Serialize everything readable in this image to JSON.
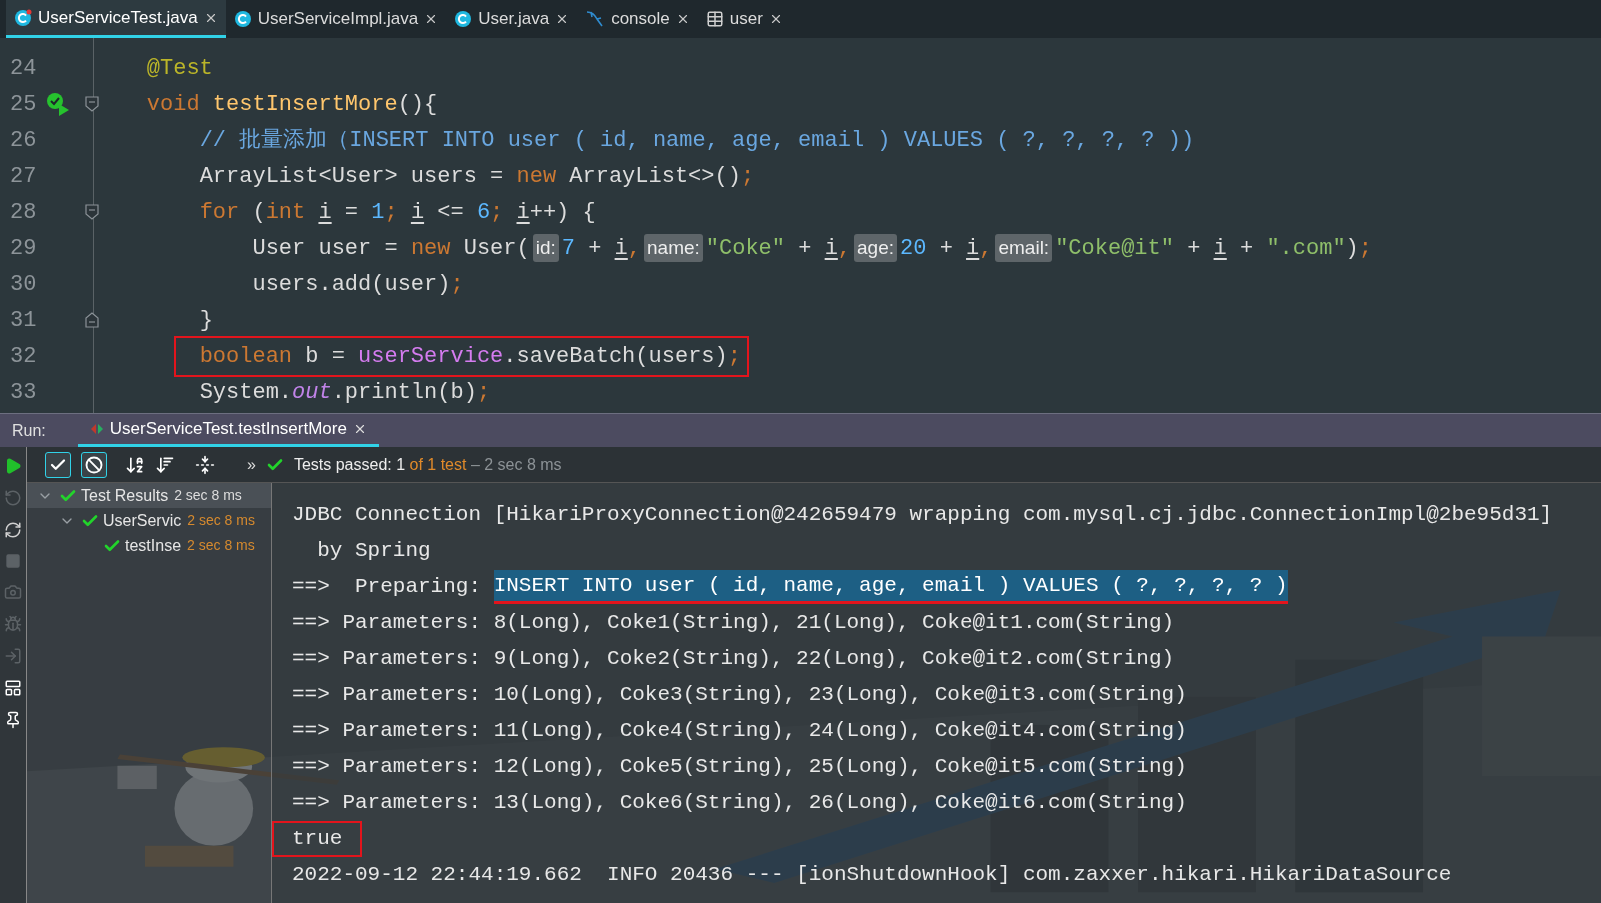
{
  "tabs": [
    {
      "label": "UserServiceTest.java",
      "kind": "test-class",
      "selected": true
    },
    {
      "label": "UserServiceImpl.java",
      "kind": "class",
      "selected": false
    },
    {
      "label": "User.java",
      "kind": "class",
      "selected": false
    },
    {
      "label": "console",
      "kind": "console",
      "selected": false
    },
    {
      "label": "user",
      "kind": "table",
      "selected": false
    }
  ],
  "editor": {
    "lines": [
      {
        "number": "24",
        "kind": "code",
        "run_icon": false,
        "boxed": false,
        "tokens": [
          {
            "kind": "annotation",
            "text": "    @Test"
          }
        ]
      },
      {
        "number": "25",
        "kind": "fold-start",
        "run_icon": true,
        "boxed": false,
        "tokens": [
          {
            "kind": "keyword",
            "text": "    void"
          },
          {
            "kind": "method",
            "text": " testInsertMore"
          },
          {
            "kind": "plain",
            "text": "(){"
          }
        ]
      },
      {
        "number": "26",
        "kind": "code",
        "run_icon": false,
        "boxed": false,
        "tokens": [
          {
            "kind": "comment",
            "text": "        // 批量添加（INSERT INTO user ( id, name, age, email ) VALUES ( ?, ?, ?, ? ))"
          }
        ]
      },
      {
        "number": "27",
        "kind": "code",
        "run_icon": false,
        "boxed": false,
        "tokens": [
          {
            "kind": "plain",
            "text": "        ArrayList<User> users = "
          },
          {
            "kind": "keyword",
            "text": "new"
          },
          {
            "kind": "plain",
            "text": " ArrayList<>()"
          },
          {
            "kind": "keyword",
            "text": ";"
          }
        ]
      },
      {
        "number": "28",
        "kind": "fold-start",
        "run_icon": false,
        "boxed": false,
        "tokens": [
          {
            "kind": "keyword",
            "text": "        for"
          },
          {
            "kind": "plain",
            "text": " ("
          },
          {
            "kind": "keyword",
            "text": "int "
          },
          {
            "kind": "var",
            "text": "i"
          },
          {
            "kind": "plain",
            "text": " = "
          },
          {
            "kind": "number",
            "text": "1"
          },
          {
            "kind": "keyword",
            "text": "; "
          },
          {
            "kind": "var",
            "text": "i"
          },
          {
            "kind": "plain",
            "text": " <= "
          },
          {
            "kind": "number",
            "text": "6"
          },
          {
            "kind": "keyword",
            "text": "; "
          },
          {
            "kind": "var",
            "text": "i"
          },
          {
            "kind": "plain",
            "text": "++) {"
          }
        ]
      },
      {
        "number": "29",
        "kind": "code",
        "run_icon": false,
        "boxed": false,
        "tokens": [
          {
            "kind": "plain",
            "text": "            User user = "
          },
          {
            "kind": "keyword",
            "text": "new"
          },
          {
            "kind": "plain",
            "text": " User("
          },
          {
            "kind": "hint",
            "text": "id:"
          },
          {
            "kind": "number",
            "text": "7"
          },
          {
            "kind": "plain",
            "text": " + "
          },
          {
            "kind": "var",
            "text": "i"
          },
          {
            "kind": "keyword",
            "text": ","
          },
          {
            "kind": "hint",
            "text": "name:"
          },
          {
            "kind": "string",
            "text": "\"Coke\""
          },
          {
            "kind": "plain",
            "text": " + "
          },
          {
            "kind": "var",
            "text": "i"
          },
          {
            "kind": "keyword",
            "text": ","
          },
          {
            "kind": "hint",
            "text": "age:"
          },
          {
            "kind": "number",
            "text": "20"
          },
          {
            "kind": "plain",
            "text": " + "
          },
          {
            "kind": "var",
            "text": "i"
          },
          {
            "kind": "keyword",
            "text": ","
          },
          {
            "kind": "hint",
            "text": "email:"
          },
          {
            "kind": "string",
            "text": "\"Coke@it\""
          },
          {
            "kind": "plain",
            "text": " + "
          },
          {
            "kind": "var",
            "text": "i"
          },
          {
            "kind": "plain",
            "text": " + "
          },
          {
            "kind": "string",
            "text": "\".com\""
          },
          {
            "kind": "plain",
            "text": ")"
          },
          {
            "kind": "keyword",
            "text": ";"
          }
        ]
      },
      {
        "number": "30",
        "kind": "code",
        "run_icon": false,
        "boxed": false,
        "tokens": [
          {
            "kind": "plain",
            "text": "            users.add(user)"
          },
          {
            "kind": "keyword",
            "text": ";"
          }
        ]
      },
      {
        "number": "31",
        "kind": "fold-end",
        "run_icon": false,
        "boxed": false,
        "tokens": [
          {
            "kind": "plain",
            "text": "        }"
          }
        ]
      },
      {
        "number": "32",
        "kind": "code",
        "run_icon": false,
        "boxed": true,
        "tokens": [
          {
            "kind": "keyword",
            "text": "        boolean"
          },
          {
            "kind": "plain",
            "text": " b = "
          },
          {
            "kind": "field",
            "text": "userService"
          },
          {
            "kind": "plain",
            "text": ".saveBatch(users)"
          },
          {
            "kind": "keyword",
            "text": ";"
          }
        ]
      },
      {
        "number": "33",
        "kind": "code",
        "run_icon": false,
        "boxed": false,
        "tokens": [
          {
            "kind": "plain",
            "text": "        System."
          },
          {
            "kind": "static",
            "text": "out"
          },
          {
            "kind": "plain",
            "text": ".println(b)"
          },
          {
            "kind": "keyword",
            "text": ";"
          }
        ]
      }
    ]
  },
  "run": {
    "label": "Run:",
    "tab": {
      "label": "UserServiceTest.testInsertMore",
      "selected": true
    },
    "status": {
      "passed": "Tests passed: 1",
      "of": "of 1 test",
      "time": "– 2 sec 8 ms"
    },
    "more": "»",
    "toggles": [
      {
        "kind": "show-passed",
        "on": true
      },
      {
        "kind": "show-ignored",
        "on": true
      }
    ],
    "tree": [
      {
        "label": "Test Results",
        "time": "2 sec 8 ms",
        "selected": true,
        "expanded": true,
        "children": [
          {
            "label": "UserServic",
            "time": "2 sec 8 ms",
            "selected": false,
            "expanded": true,
            "children": [
              {
                "label": "testInse",
                "time": "2 sec 8 ms",
                "selected": false
              }
            ]
          }
        ]
      }
    ],
    "console": [
      {
        "boxed": false,
        "segments": [
          {
            "kind": "plain",
            "text": "JDBC Connection [HikariProxyConnection@242659479 wrapping com.mysql.cj.jdbc.ConnectionImpl@2be95d31]"
          }
        ]
      },
      {
        "boxed": false,
        "segments": [
          {
            "kind": "plain",
            "text": "  by Spring"
          }
        ]
      },
      {
        "boxed": false,
        "segments": [
          {
            "kind": "plain",
            "text": "==>  Preparing: "
          },
          {
            "kind": "selection",
            "text": "INSERT INTO user ( id, name, age, email ) VALUES ( ?, ?, ?, ? )"
          }
        ]
      },
      {
        "boxed": false,
        "segments": [
          {
            "kind": "plain",
            "text": "==> Parameters: 8(Long), Coke1(String), 21(Long), Coke@it1.com(String)"
          }
        ]
      },
      {
        "boxed": false,
        "segments": [
          {
            "kind": "plain",
            "text": "==> Parameters: 9(Long), Coke2(String), 22(Long), Coke@it2.com(String)"
          }
        ]
      },
      {
        "boxed": false,
        "segments": [
          {
            "kind": "plain",
            "text": "==> Parameters: 10(Long), Coke3(String), 23(Long), Coke@it3.com(String)"
          }
        ]
      },
      {
        "boxed": false,
        "segments": [
          {
            "kind": "plain",
            "text": "==> Parameters: 11(Long), Coke4(String), 24(Long), Coke@it4.com(String)"
          }
        ]
      },
      {
        "boxed": false,
        "segments": [
          {
            "kind": "plain",
            "text": "==> Parameters: 12(Long), Coke5(String), 25(Long), Coke@it5.com(String)"
          }
        ]
      },
      {
        "boxed": false,
        "segments": [
          {
            "kind": "plain",
            "text": "==> Parameters: 13(Long), Coke6(String), 26(Long), Coke@it6.com(String)"
          }
        ]
      },
      {
        "boxed": true,
        "segments": [
          {
            "kind": "plain",
            "text": "true"
          }
        ]
      },
      {
        "boxed": false,
        "segments": [
          {
            "kind": "plain",
            "text": "2022-09-12 22:44:19.662  INFO 20436 --- [ionShutdownHook] com.zaxxer.hikari.HikariDataSource"
          }
        ]
      }
    ]
  }
}
